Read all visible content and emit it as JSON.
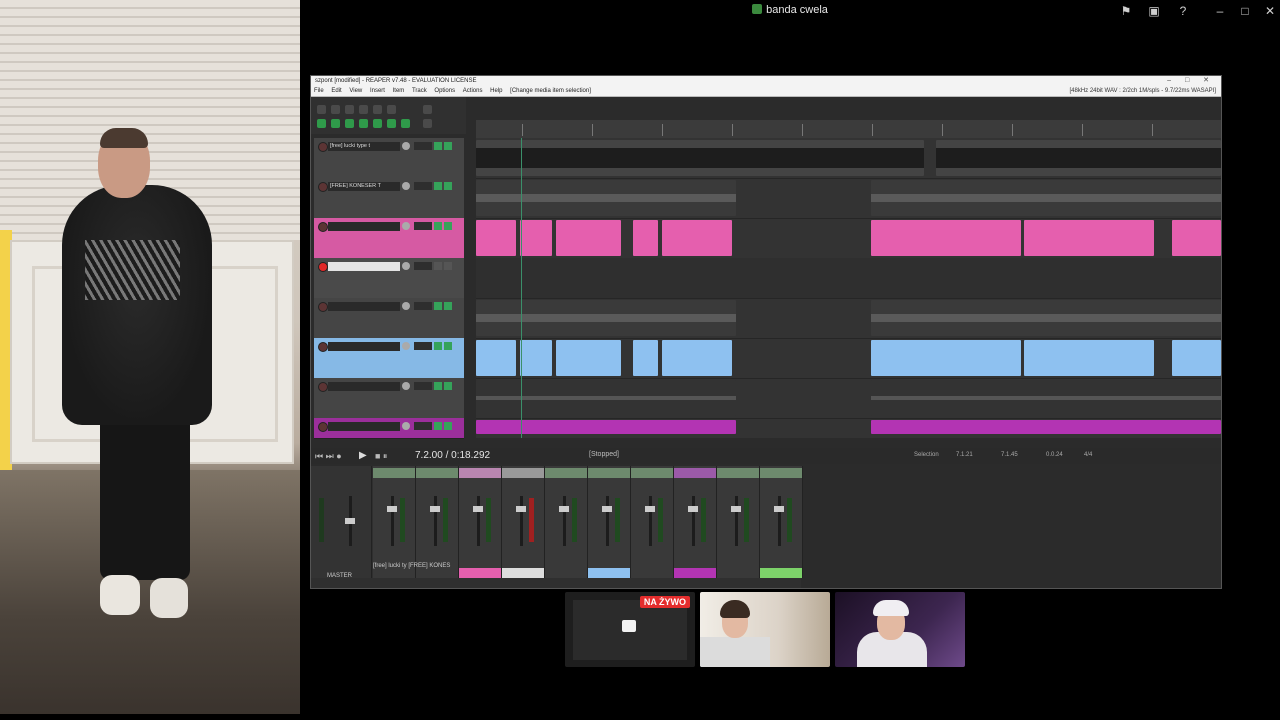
{
  "window": {
    "title": "banda cwela"
  },
  "top_icons": [
    "flag-icon",
    "screen-icon",
    "help-icon",
    "minimize-icon",
    "maximize-icon",
    "close-icon"
  ],
  "reaper": {
    "title": "szpont [modified] - REAPER v7.48 - EVALUATION LICENSE",
    "menu": [
      "File",
      "Edit",
      "View",
      "Insert",
      "Item",
      "Track",
      "Options",
      "Actions",
      "Help"
    ],
    "menu_status": "[Change media item selection]",
    "audio_status": "[48kHz 24bit WAV : 2/2ch 1M/spls - 9.7/22ms WASAPI]",
    "tracks": [
      {
        "name": "[free] lucki type t",
        "color": "#3a3a3a"
      },
      {
        "name": "[FREE] KONESER T",
        "color": "#3a3a3a"
      },
      {
        "name": "",
        "color": "#e55fae"
      },
      {
        "name": "",
        "color": "#cfcfcf"
      },
      {
        "name": "",
        "color": "#3a3a3a"
      },
      {
        "name": "",
        "color": "#7db4e8"
      },
      {
        "name": "",
        "color": "#3a3a3a"
      },
      {
        "name": "",
        "color": "#b334b3"
      }
    ],
    "transport": {
      "time": "7.2.00 / 0:18.292",
      "status": "[Stopped]",
      "selection_label": "Selection",
      "selection_values": [
        "7.1.21",
        "7.1.45",
        "0.0.24"
      ],
      "tempo_sig": "4/4"
    },
    "mixer": {
      "master_label": "MASTER",
      "track_labels": "[free] lucki ty  [FREE] KONES"
    }
  },
  "thumbnails": {
    "live_badge": "NA ŻYWO"
  },
  "colors": {
    "pink": "#e55fae",
    "blue": "#8ec1f0",
    "purple": "#b334b3",
    "green": "#2f9a4a"
  }
}
